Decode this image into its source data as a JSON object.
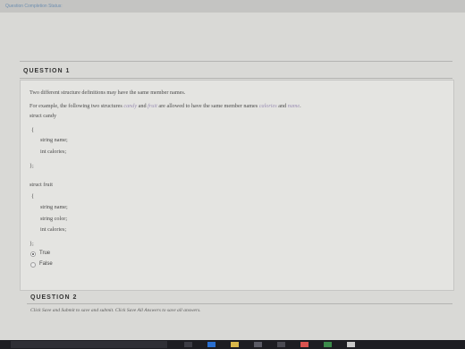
{
  "top_status": "Question Completion Status:",
  "question1": {
    "heading": "QUESTION 1",
    "intro": "Two different structure definitions may have the same member names.",
    "example_prefix": "For example, the following two structures ",
    "name_candy": "candy",
    "and_word": " and ",
    "name_fruit": "fruit",
    "example_mid": " are allowed to have the same member names ",
    "member_calories": "calories",
    "and_word2": " and ",
    "member_name": "name",
    "period": ".",
    "code": {
      "candy_decl": "struct candy",
      "open_brace_1": "{",
      "candy_m1": "string name;",
      "candy_m2": "int calories;",
      "close_1": "};",
      "fruit_decl": "struct fruit",
      "open_brace_2": "{",
      "fruit_m1": "string name;",
      "fruit_m2": "string color;",
      "fruit_m3": "int calories;",
      "close_2": "};"
    },
    "options": [
      {
        "label": "True",
        "selected": true
      },
      {
        "label": "False",
        "selected": false
      }
    ]
  },
  "question2": {
    "heading": "QUESTION 2",
    "instructions": "Click Save and Submit to save and submit. Click Save All Answers to save all answers."
  },
  "colors": {
    "italic_name": "#9b8fb4",
    "status_link": "#6f8fb0"
  }
}
